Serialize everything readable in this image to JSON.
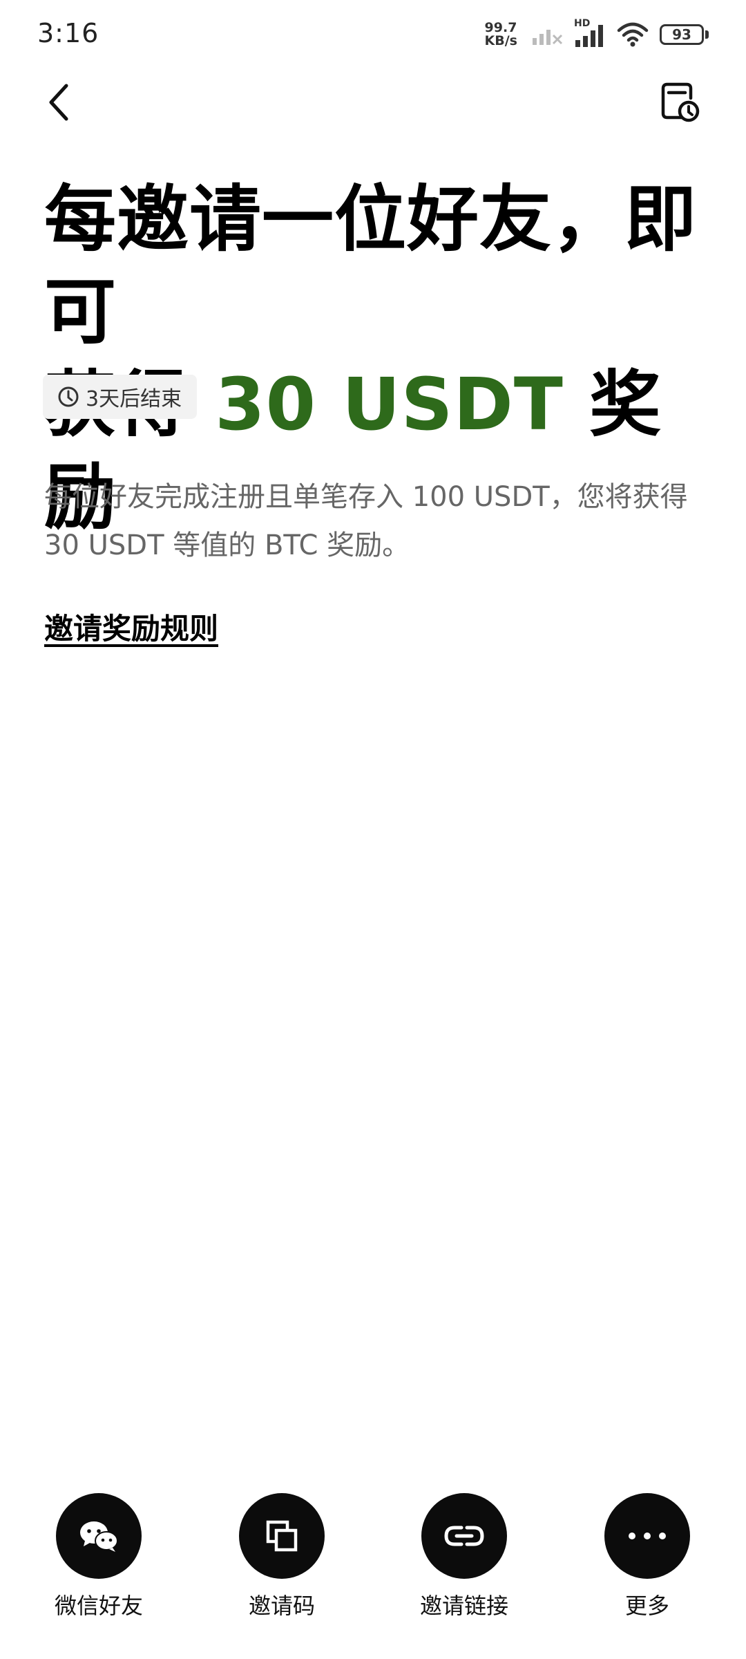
{
  "status_bar": {
    "time": "3:16",
    "net_speed_value": "99.7",
    "net_speed_unit": "KB/s",
    "hd_label": "HD",
    "battery": "93"
  },
  "nav": {
    "back_icon": "chevron-left-icon",
    "history_icon": "calendar-clock-icon"
  },
  "headline": {
    "line1": "每邀请一位好友，即可",
    "line2_prefix": "获得 ",
    "amount": "30 USDT",
    "line2_suffix": " 奖励",
    "accent_color": "#2e6a1b"
  },
  "countdown": {
    "icon": "clock-icon",
    "text": "3天后结束"
  },
  "description": "每位好友完成注册且单笔存入 100 USDT，您将获得 30 USDT 等值的 BTC 奖励。",
  "rules_link": "邀请奖励规则",
  "share": [
    {
      "label": "微信好友",
      "icon": "wechat-icon"
    },
    {
      "label": "邀请码",
      "icon": "copy-icon"
    },
    {
      "label": "邀请链接",
      "icon": "link-icon"
    },
    {
      "label": "更多",
      "icon": "more-icon"
    }
  ]
}
